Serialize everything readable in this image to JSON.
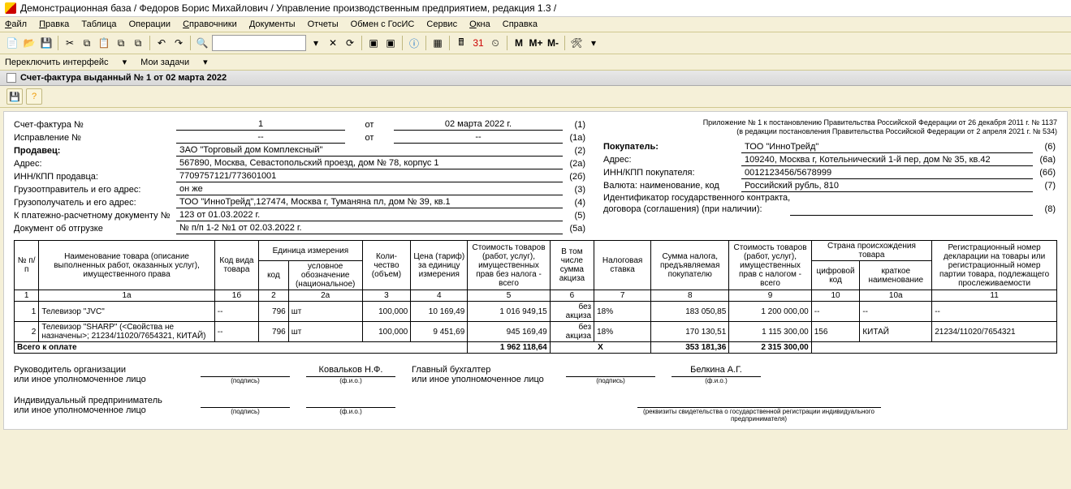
{
  "title": "Демонстрационная база / Федоров Борис Михайлович / Управление производственным предприятием, редакция 1.3 /",
  "menu": {
    "file": "Файл",
    "edit": "Правка",
    "table": "Таблица",
    "ops": "Операции",
    "refs": "Справочники",
    "docs": "Документы",
    "reports": "Отчеты",
    "gosis": "Обмен с ГосИС",
    "service": "Сервис",
    "windows": "Окна",
    "help": "Справка"
  },
  "switcher": {
    "iface": "Переключить интерфейс",
    "tasks": "Мои задачи"
  },
  "toolbar_m": {
    "m": "M",
    "mp": "M+",
    "mm": "M-"
  },
  "doctab": "Счет-фактура выданный № 1 от 02 марта 2022",
  "appendix": {
    "l1": "Приложение № 1 к постановлению Правительства Российской Федерации от 26 декабря 2011 г. № 1137",
    "l2": "(в редакции постановления Правительства Российской Федерации от 2 апреля 2021 г. № 534)"
  },
  "hdr": {
    "invoice_lbl": "Счет-фактура №",
    "invoice_no": "1",
    "ot": "от",
    "invoice_date": "02 марта 2022 г.",
    "n1": "(1)",
    "corr_lbl": "Исправление №",
    "corr_no": "--",
    "corr_date": "--",
    "n1a": "(1а)",
    "seller_lbl": "Продавец:",
    "seller": "ЗАО \"Торговый дом Комплексный\"",
    "n2": "(2)",
    "addr_lbl": "Адрес:",
    "addr": "567890, Москва, Севастопольский проезд, дом № 78, корпус 1",
    "n2a": "(2а)",
    "inn_lbl": "ИНН/КПП продавца:",
    "inn": "7709757121/773601001",
    "n2b": "(2б)",
    "shipper_lbl": "Грузоотправитель и его адрес:",
    "shipper": "он же",
    "n3": "(3)",
    "cons_lbl": "Грузополучатель и его адрес:",
    "cons": "ТОО \"ИнноТрейд\",127474, Москва г, Туманяна пл, дом № 39, кв.1",
    "n4": "(4)",
    "pay_lbl": "К платежно-расчетному документу №",
    "pay": "123 от 01.03.2022 г.",
    "n5": "(5)",
    "ship_lbl": "Документ об отгрузке",
    "ship": "№ п/п 1-2 №1 от 02.03.2022 г.",
    "n5a": "(5а)",
    "buyer_lbl": "Покупатель:",
    "buyer": "ТОО \"ИнноТрейд\"",
    "n6": "(6)",
    "baddr_lbl": "Адрес:",
    "baddr": "109240, Москва г, Котельнический 1-й пер, дом № 35, кв.42",
    "n6a": "(6а)",
    "binn_lbl": "ИНН/КПП покупателя:",
    "binn": "0012123456/5678999",
    "n6b": "(6б)",
    "cur_lbl": "Валюта: наименование, код",
    "cur": "Российский рубль, 810",
    "n7": "(7)",
    "contract_lbl1": "Идентификатор государственного контракта,",
    "contract_lbl2": "договора (соглашения) (при наличии):",
    "n8": "(8)"
  },
  "cols": {
    "npp": "№ п/п",
    "name": "Наименование товара (описание выполненных работ, оказанных услуг), имущественного права",
    "kindcode": "Код вида товара",
    "unit": "Единица измерения",
    "unit_code": "код",
    "unit_name": "условное обозначение (национальное)",
    "qty": "Коли- чество (объем)",
    "price": "Цена (тариф) за единицу измерения",
    "cost_notax": "Стоимость товаров (работ, услуг), имущественных прав без налога - всего",
    "excise": "В том числе сумма акциза",
    "rate": "Налоговая ставка",
    "tax": "Сумма налога, предъявляемая покупателю",
    "cost_tax": "Стоимость товаров (работ, услуг), имущественных прав с налогом - всего",
    "country": "Страна происхождения товара",
    "ccode": "цифровой код",
    "cname": "краткое наименование",
    "reg": "Регистрационный номер декларации на товары или регистрационный номер партии товара, подлежащего прослеживаемости"
  },
  "colnums": {
    "c1": "1",
    "c1a": "1а",
    "c1b": "1б",
    "c2": "2",
    "c2a": "2а",
    "c3": "3",
    "c4": "4",
    "c5": "5",
    "c6": "6",
    "c7": "7",
    "c8": "8",
    "c9": "9",
    "c10": "10",
    "c10a": "10а",
    "c11": "11"
  },
  "rows": [
    {
      "n": "1",
      "name": "Телевизор \"JVC\"",
      "kind": "--",
      "ucode": "796",
      "uname": "шт",
      "qty": "100,000",
      "price": "10 169,49",
      "cost": "1 016 949,15",
      "excise": "без акциза",
      "rate": "18%",
      "tax": "183 050,85",
      "costtax": "1 200 000,00",
      "ccode": "--",
      "cname": "--",
      "reg": "--"
    },
    {
      "n": "2",
      "name": "Телевизор \"SHARP\" (<Свойства не назначены>; 21234/11020/7654321, КИТАЙ)",
      "kind": "--",
      "ucode": "796",
      "uname": "шт",
      "qty": "100,000",
      "price": "9 451,69",
      "cost": "945 169,49",
      "excise": "без акциза",
      "rate": "18%",
      "tax": "170 130,51",
      "costtax": "1 115 300,00",
      "ccode": "156",
      "cname": "КИТАЙ",
      "reg": "21234/11020/7654321"
    }
  ],
  "total": {
    "lbl": "Всего к оплате",
    "cost": "1 962 118,64",
    "x": "X",
    "tax": "353 181,36",
    "costtax": "2 315 300,00"
  },
  "sig": {
    "head_lbl": "Руководитель организации",
    "or": "или иное уполномоченное лицо",
    "head_name": "Ковальков Н.Ф.",
    "acc_lbl": "Главный бухгалтер",
    "acc_name": "Белкина А.Г.",
    "ip_lbl": "Индивидуальный предприниматель",
    "podpis": "(подпись)",
    "fio": "(ф.и.о.)",
    "rekv": "(реквизиты свидетельства о государственной регистрации индивидуального предпринимателя)"
  }
}
